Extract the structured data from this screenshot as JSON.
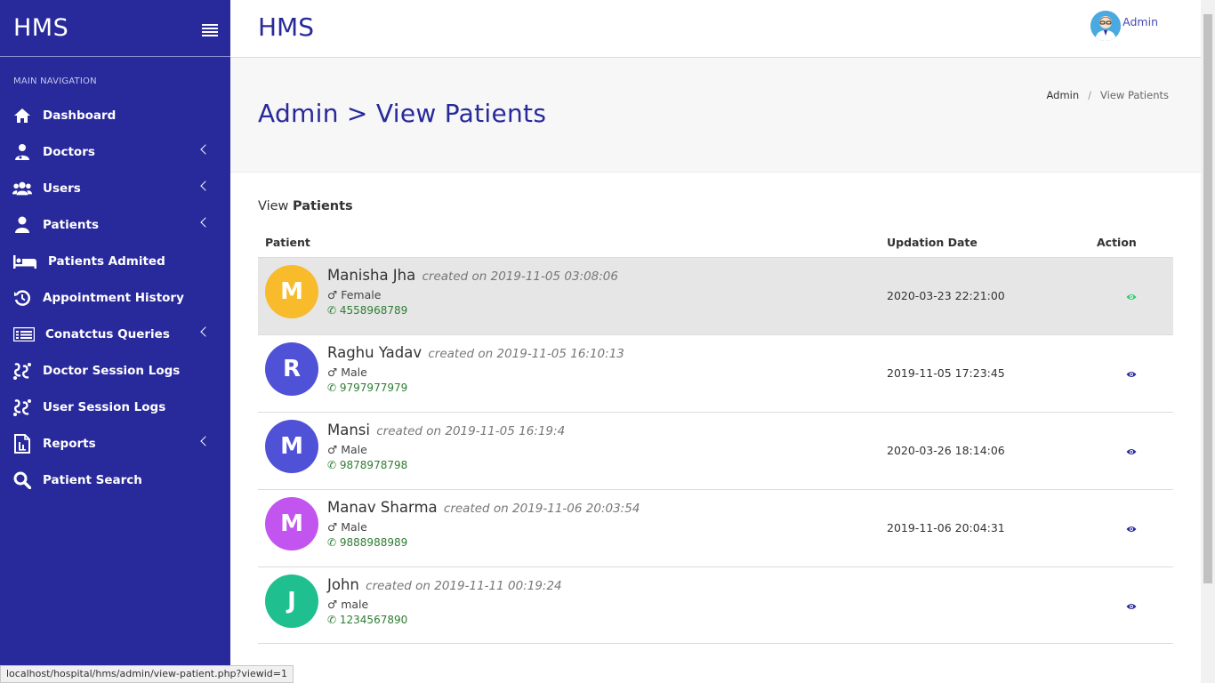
{
  "sidebar": {
    "brand": "HMS",
    "nav_header": "MAIN NAVIGATION",
    "items": [
      {
        "label": "Dashboard",
        "icon": "home-icon"
      },
      {
        "label": "Doctors",
        "icon": "doctor-icon"
      },
      {
        "label": "Users",
        "icon": "users-icon"
      },
      {
        "label": "Patients",
        "icon": "patient-icon"
      },
      {
        "label": "Patients Admited",
        "icon": "bed-icon"
      },
      {
        "label": "Appointment History",
        "icon": "history-icon"
      },
      {
        "label": "Conatctus Queries",
        "icon": "list-icon"
      },
      {
        "label": "Doctor Session Logs",
        "icon": "logs-icon"
      },
      {
        "label": "User Session Logs",
        "icon": "logs-icon"
      },
      {
        "label": "Reports",
        "icon": "report-icon"
      },
      {
        "label": "Patient Search",
        "icon": "search-icon"
      }
    ]
  },
  "topbar": {
    "title": "HMS",
    "user_name": "Admin"
  },
  "page": {
    "title": "Admin > View Patients",
    "breadcrumb": [
      "Admin",
      "View Patients"
    ]
  },
  "table": {
    "section_prefix": "View",
    "section_bold": "Patients",
    "headers": {
      "patient": "Patient",
      "date": "Updation Date",
      "action": "Action"
    },
    "rows": [
      {
        "initial": "M",
        "name": "Manisha Jha",
        "created": "created on 2019-11-05 03:08:06",
        "gender": "Female",
        "phone": "4558968789",
        "updated": "2020-03-23 22:21:00"
      },
      {
        "initial": "R",
        "name": "Raghu Yadav",
        "created": "created on 2019-11-05 16:10:13",
        "gender": "Male",
        "phone": "9797977979",
        "updated": "2019-11-05 17:23:45"
      },
      {
        "initial": "M",
        "name": "Mansi",
        "created": "created on 2019-11-05 16:19:4",
        "gender": "Male",
        "phone": "9878978798",
        "updated": "2020-03-26 18:14:06"
      },
      {
        "initial": "M",
        "name": "Manav Sharma",
        "created": "created on 2019-11-06 20:03:54",
        "gender": "Male",
        "phone": "9888988989",
        "updated": "2019-11-06 20:04:31"
      },
      {
        "initial": "J",
        "name": "John",
        "created": "created on 2019-11-11 00:19:24",
        "gender": "male",
        "phone": "1234567890",
        "updated": ""
      }
    ]
  },
  "status_url": "localhost/hospital/hms/admin/view-patient.php?viewid=1",
  "colors": {
    "sidebar": "#28299a",
    "accent": "#28299a",
    "avatar_yellow": "#f7bb2c",
    "avatar_indigo": "#4f52d6",
    "avatar_purple": "#c255f0",
    "avatar_teal": "#1fbf8f",
    "phone_green": "#2e7d32",
    "eye_green": "#2ecc71",
    "eye_blue": "#28299a"
  }
}
